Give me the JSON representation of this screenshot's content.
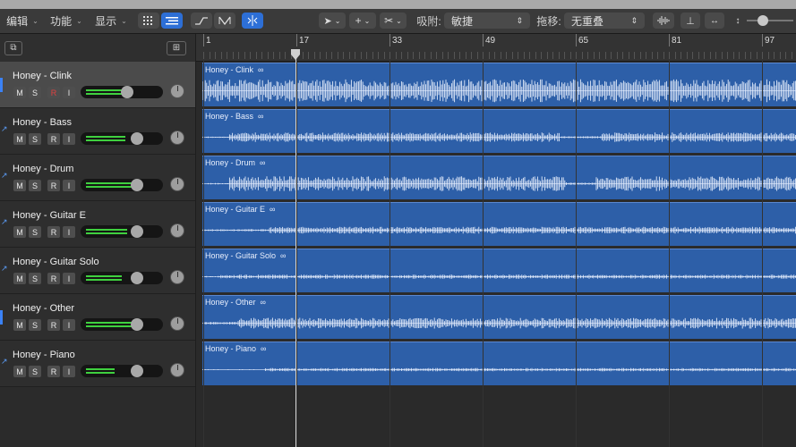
{
  "toolbar": {
    "menus": [
      "编辑",
      "功能",
      "显示"
    ],
    "snap_label": "吸附:",
    "snap_value": "敏捷",
    "drag_label": "拖移:",
    "drag_value": "无重叠"
  },
  "ruler": {
    "bars": [
      "1",
      "17",
      "33",
      "49",
      "65",
      "81",
      "97"
    ]
  },
  "tracks": [
    {
      "name": "Honey - Clink",
      "region": "Honey - Clink",
      "selected": true,
      "rec_enabled": true,
      "fader": 0.58,
      "meter": 0.62
    },
    {
      "name": "Honey - Bass",
      "region": "Honey - Bass",
      "selected": false,
      "rec_enabled": false,
      "fader": 0.72,
      "meter": 0.55
    },
    {
      "name": "Honey - Drum",
      "region": "Honey - Drum",
      "selected": false,
      "rec_enabled": false,
      "fader": 0.72,
      "meter": 0.7
    },
    {
      "name": "Honey - Guitar E",
      "region": "Honey - Guitar E",
      "selected": false,
      "rec_enabled": false,
      "fader": 0.72,
      "meter": 0.58
    },
    {
      "name": "Honey - Guitar Solo",
      "region": "Honey - Guitar Solo",
      "selected": false,
      "rec_enabled": false,
      "fader": 0.72,
      "meter": 0.5
    },
    {
      "name": "Honey - Other",
      "region": "Honey - Other",
      "selected": false,
      "rec_enabled": false,
      "fader": 0.72,
      "meter": 0.68
    },
    {
      "name": "Honey - Piano",
      "region": "Honey - Piano",
      "selected": false,
      "rec_enabled": false,
      "fader": 0.72,
      "meter": 0.4
    }
  ],
  "icons": {
    "pointer": "pointer-tool-icon",
    "pencil": "pencil-tool-icon",
    "scissors": "scissors-tool-icon"
  },
  "colors": {
    "region": "#2d5fa8",
    "accent": "#2d6fd6",
    "meter": "#3fd03f"
  }
}
